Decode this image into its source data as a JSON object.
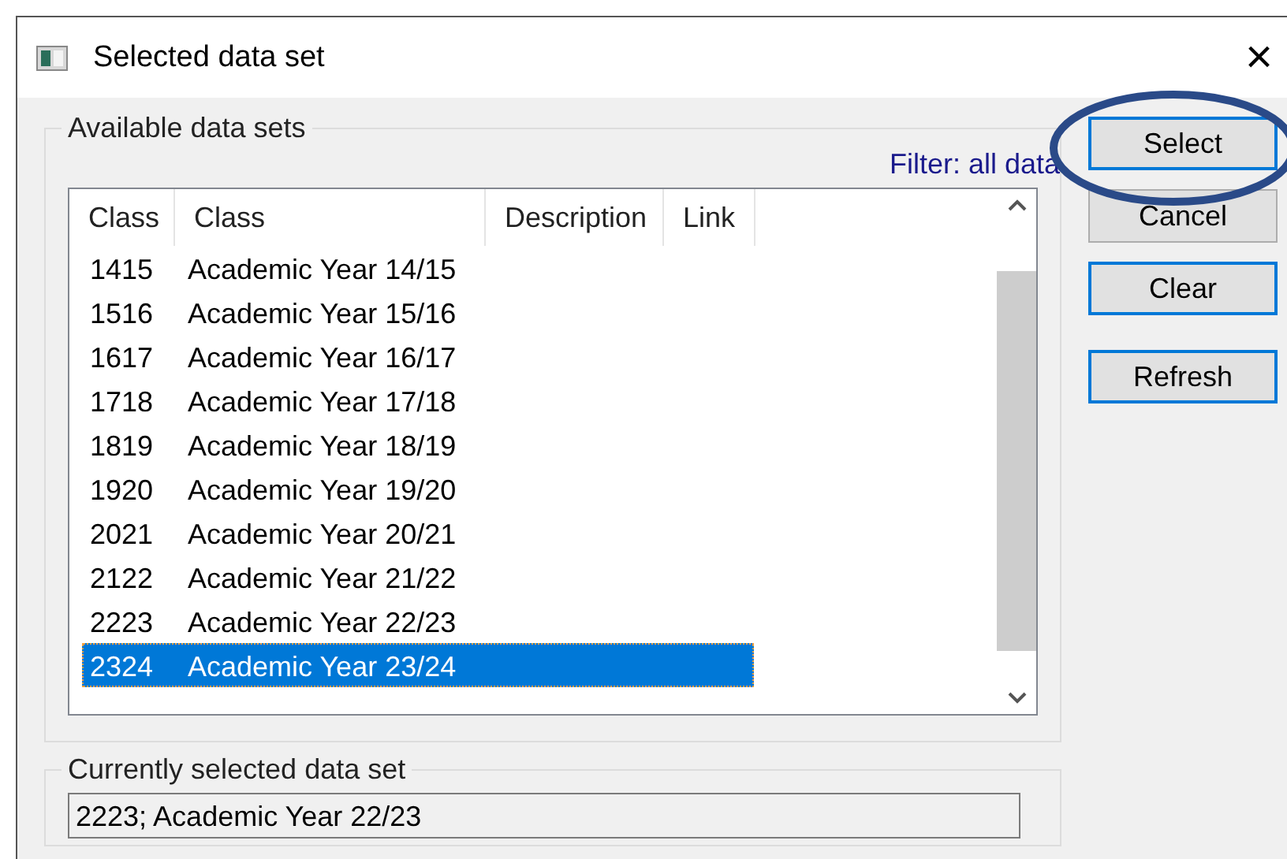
{
  "window": {
    "title": "Selected data set",
    "close": "×"
  },
  "available": {
    "label": "Available data sets",
    "filter": "Filter: all data",
    "columns": [
      "Class",
      "Class",
      "Description",
      "Link"
    ],
    "rows": [
      {
        "code": "1415",
        "name": "Academic Year 14/15",
        "selected": false
      },
      {
        "code": "1516",
        "name": "Academic Year 15/16",
        "selected": false
      },
      {
        "code": "1617",
        "name": "Academic Year 16/17",
        "selected": false
      },
      {
        "code": "1718",
        "name": "Academic Year 17/18",
        "selected": false
      },
      {
        "code": "1819",
        "name": "Academic Year 18/19",
        "selected": false
      },
      {
        "code": "1920",
        "name": "Academic Year 19/20",
        "selected": false
      },
      {
        "code": "2021",
        "name": "Academic Year 20/21",
        "selected": false
      },
      {
        "code": "2122",
        "name": "Academic Year 21/22",
        "selected": false
      },
      {
        "code": "2223",
        "name": "Academic Year 22/23",
        "selected": false
      },
      {
        "code": "2324",
        "name": "Academic Year 23/24",
        "selected": true
      }
    ]
  },
  "buttons": [
    {
      "label": "Select",
      "focused": true
    },
    {
      "label": "Cancel",
      "focused": false
    },
    {
      "label": "Clear",
      "focused": true
    },
    {
      "label": "Refresh",
      "focused": true
    }
  ],
  "current": {
    "label": "Currently selected data set",
    "value": "2223; Academic Year 22/23"
  }
}
